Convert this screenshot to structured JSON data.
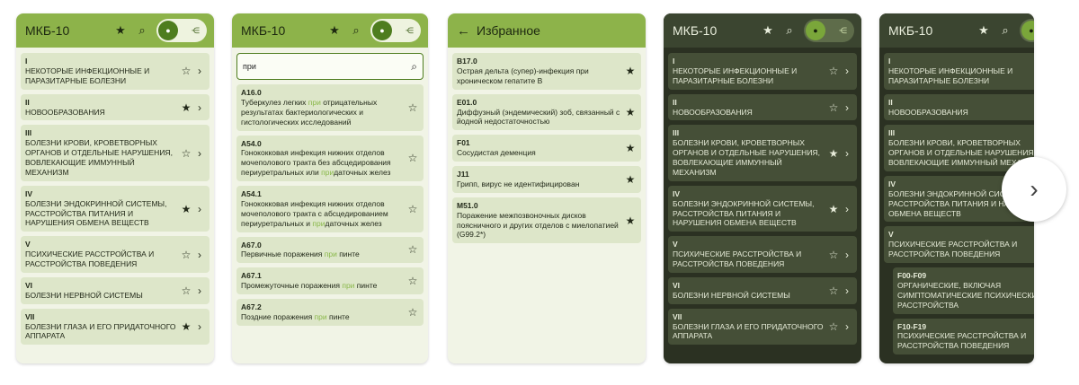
{
  "screens": {
    "s1": {
      "title": "МКБ-10",
      "items": [
        {
          "code": "I",
          "name": "НЕКОТОРЫЕ ИНФЕКЦИОННЫЕ И ПАРАЗИТАРНЫЕ БОЛЕЗНИ",
          "fav": false
        },
        {
          "code": "II",
          "name": "НОВООБРАЗОВАНИЯ",
          "fav": true
        },
        {
          "code": "III",
          "name": "БОЛЕЗНИ КРОВИ, КРОВЕТВОРНЫХ ОРГАНОВ И ОТДЕЛЬНЫЕ НАРУШЕНИЯ, ВОВЛЕКАЮЩИЕ ИММУННЫЙ МЕХАНИЗМ",
          "fav": false
        },
        {
          "code": "IV",
          "name": "БОЛЕЗНИ ЭНДОКРИННОЙ СИСТЕМЫ, РАССТРОЙСТВА ПИТАНИЯ И НАРУШЕНИЯ ОБМЕНА ВЕЩЕСТВ",
          "fav": true
        },
        {
          "code": "V",
          "name": "ПСИХИЧЕСКИЕ РАССТРОЙСТВА И РАССТРОЙСТВА ПОВЕДЕНИЯ",
          "fav": false
        },
        {
          "code": "VI",
          "name": "БОЛЕЗНИ НЕРВНОЙ СИСТЕМЫ",
          "fav": false
        },
        {
          "code": "VII",
          "name": "БОЛЕЗНИ ГЛАЗА И ЕГО ПРИДАТОЧНОГО АППАРАТА",
          "fav": true
        }
      ]
    },
    "s2": {
      "title": "МКБ-10",
      "search_value": "при",
      "results": [
        {
          "code": "A16.0",
          "pre": "Туберкулез легких ",
          "hl": "при",
          "post": " отрицательных результатах бактериологических и гистологических исследований"
        },
        {
          "code": "A54.0",
          "pre": "Гонококковая инфекция нижних отделов мочеполового тракта без абсцедирования периуретральных или ",
          "hl": "при",
          "post": "даточных желез"
        },
        {
          "code": "A54.1",
          "pre": "Гонококковая инфекция нижних отделов мочеполового тракта с абсцедированием периуретральных и ",
          "hl": "при",
          "post": "даточных желез"
        },
        {
          "code": "A67.0",
          "pre": "Первичные поражения ",
          "hl": "при",
          "post": " пинте"
        },
        {
          "code": "A67.1",
          "pre": "Промежуточные поражения ",
          "hl": "при",
          "post": " пинте"
        },
        {
          "code": "A67.2",
          "pre": "Поздние поражения ",
          "hl": "при",
          "post": " пинте"
        }
      ]
    },
    "s3": {
      "title": "Избранное",
      "items": [
        {
          "code": "B17.0",
          "name": "Острая дельта (супер)-инфекция при хроническом гепатите B"
        },
        {
          "code": "E01.0",
          "name": "Диффузный (эндемический) зоб, связанный с йодной недостаточностью"
        },
        {
          "code": "F01",
          "name": "Сосудистая деменция"
        },
        {
          "code": "J11",
          "name": "Грипп, вирус не идентифицирован"
        },
        {
          "code": "M51.0",
          "name": "Поражение межпозвоночных дисков поясничного и других отделов с миелопатией (G99.2*)"
        }
      ]
    },
    "s4": {
      "title": "МКБ-10",
      "items": [
        {
          "code": "I",
          "name": "НЕКОТОРЫЕ ИНФЕКЦИОННЫЕ И ПАРАЗИТАРНЫЕ БОЛЕЗНИ",
          "fav": false
        },
        {
          "code": "II",
          "name": "НОВООБРАЗОВАНИЯ",
          "fav": false
        },
        {
          "code": "III",
          "name": "БОЛЕЗНИ КРОВИ, КРОВЕТВОРНЫХ ОРГАНОВ И ОТДЕЛЬНЫЕ НАРУШЕНИЯ, ВОВЛЕКАЮЩИЕ ИММУННЫЙ МЕХАНИЗМ",
          "fav": true
        },
        {
          "code": "IV",
          "name": "БОЛЕЗНИ ЭНДОКРИННОЙ СИСТЕМЫ, РАССТРОЙСТВА ПИТАНИЯ И НАРУШЕНИЯ ОБМЕНА ВЕЩЕСТВ",
          "fav": true
        },
        {
          "code": "V",
          "name": "ПСИХИЧЕСКИЕ РАССТРОЙСТВА И РАССТРОЙСТВА ПОВЕДЕНИЯ",
          "fav": false
        },
        {
          "code": "VI",
          "name": "БОЛЕЗНИ НЕРВНОЙ СИСТЕМЫ",
          "fav": false
        },
        {
          "code": "VII",
          "name": "БОЛЕЗНИ ГЛАЗА И ЕГО ПРИДАТОЧНОГО АППАРАТА",
          "fav": false
        }
      ]
    },
    "s5": {
      "title": "МКБ-10",
      "items": [
        {
          "code": "I",
          "name": "НЕКОТОРЫЕ ИНФЕКЦИОННЫЕ И ПАРАЗИТАРНЫЕ БОЛЕЗНИ"
        },
        {
          "code": "II",
          "name": "НОВООБРАЗОВАНИЯ"
        },
        {
          "code": "III",
          "name": "БОЛЕЗНИ КРОВИ, КРОВЕТВОРНЫХ ОРГАНОВ И ОТДЕЛЬНЫЕ НАРУШЕНИЯ, ВОВЛЕКАЮЩИЕ ИММУННЫЙ МЕХАНИЗМ"
        },
        {
          "code": "IV",
          "name": "БОЛЕЗНИ ЭНДОКРИННОЙ СИСТЕМЫ, РАССТРОЙСТВА ПИТАНИЯ И НАРУШЕНИЯ ОБМЕНА ВЕЩЕСТВ"
        },
        {
          "code": "V",
          "name": "ПСИХИЧЕСКИЕ РАССТРОЙСТВА И РАССТРОЙСТВА ПОВЕДЕНИЯ"
        }
      ],
      "subitems": [
        {
          "code": "F00-F09",
          "name": "ОРГАНИЧЕСКИЕ, ВКЛЮЧАЯ СИМПТОМАТИЧЕСКИЕ ПСИХИЧЕСКИЕ РАССТРОЙСТВА"
        },
        {
          "code": "F10-F19",
          "name": "ПСИХИЧЕСКИЕ РАССТРОЙСТВА И РАССТРОЙСТВА ПОВЕДЕНИЯ"
        }
      ]
    }
  },
  "icons": {
    "star_filled": "★",
    "star_outline": "☆",
    "chevron": "›",
    "search": "⌕",
    "back": "←"
  },
  "colors": {
    "light_appbar": "#8db34a",
    "light_card": "#dde6c9",
    "dark_appbar": "#3b4530",
    "dark_card": "#454f37",
    "highlight": "#8ab84a"
  }
}
